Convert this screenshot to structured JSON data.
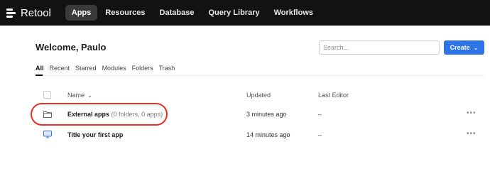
{
  "app": {
    "logo_text": "Retool"
  },
  "nav": {
    "items": [
      "Apps",
      "Resources",
      "Database",
      "Query Library",
      "Workflows"
    ],
    "active_index": 0
  },
  "header": {
    "welcome": "Welcome, Paulo",
    "search_placeholder": "Search...",
    "create_label": "Create"
  },
  "tabs": {
    "items": [
      "All",
      "Recent",
      "Starred",
      "Modules",
      "Folders",
      "Trash"
    ],
    "active_index": 0
  },
  "table": {
    "columns": {
      "name": "Name",
      "updated": "Updated",
      "last_editor": "Last Editor"
    },
    "rows": [
      {
        "name": "External apps",
        "detail": "(0 folders, 0 apps)",
        "updated": "3 minutes ago",
        "editor": "–",
        "icon": "folder-icon"
      },
      {
        "name": "Title your first app",
        "detail": "",
        "updated": "14 minutes ago",
        "editor": "–",
        "icon": "app-monitor-icon"
      }
    ]
  },
  "colors": {
    "accent": "#2f74e6",
    "nav_bg": "#121212",
    "highlight": "#e53026"
  }
}
